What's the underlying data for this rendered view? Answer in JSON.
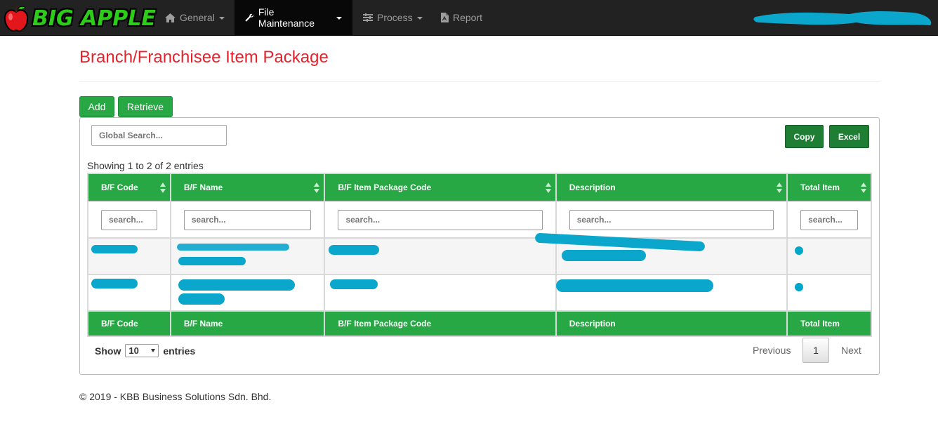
{
  "navbar": {
    "brand": "BIG APPLE",
    "items": [
      {
        "label": "General",
        "icon": "home-icon"
      },
      {
        "label": "File Maintenance",
        "icon": "wrench-icon"
      },
      {
        "label": "Process",
        "icon": "sliders-icon"
      },
      {
        "label": "Report",
        "icon": "pdf-file-icon"
      }
    ]
  },
  "page": {
    "title": "Branch/Franchisee Item Package",
    "add_label": "Add",
    "retrieve_label": "Retrieve"
  },
  "table_tools": {
    "global_search_placeholder": "Global Search...",
    "copy_label": "Copy",
    "excel_label": "Excel",
    "showing": "Showing 1 to 2 of 2 entries"
  },
  "table": {
    "columns": [
      "B/F Code",
      "B/F Name",
      "B/F Item Package Code",
      "Description",
      "Total Item"
    ],
    "search_placeholder": "search..."
  },
  "pagination": {
    "show_label": "Show",
    "entries_label": "entries",
    "page_size": "10",
    "previous": "Previous",
    "current": "1",
    "next": "Next"
  },
  "footer": {
    "text": "© 2019 - KBB Business Solutions Sdn. Bhd."
  },
  "colors": {
    "accent_green": "#28a745",
    "title_red": "#e8222c",
    "navbar_bg": "#222222",
    "redaction": "#0aa6cc"
  }
}
